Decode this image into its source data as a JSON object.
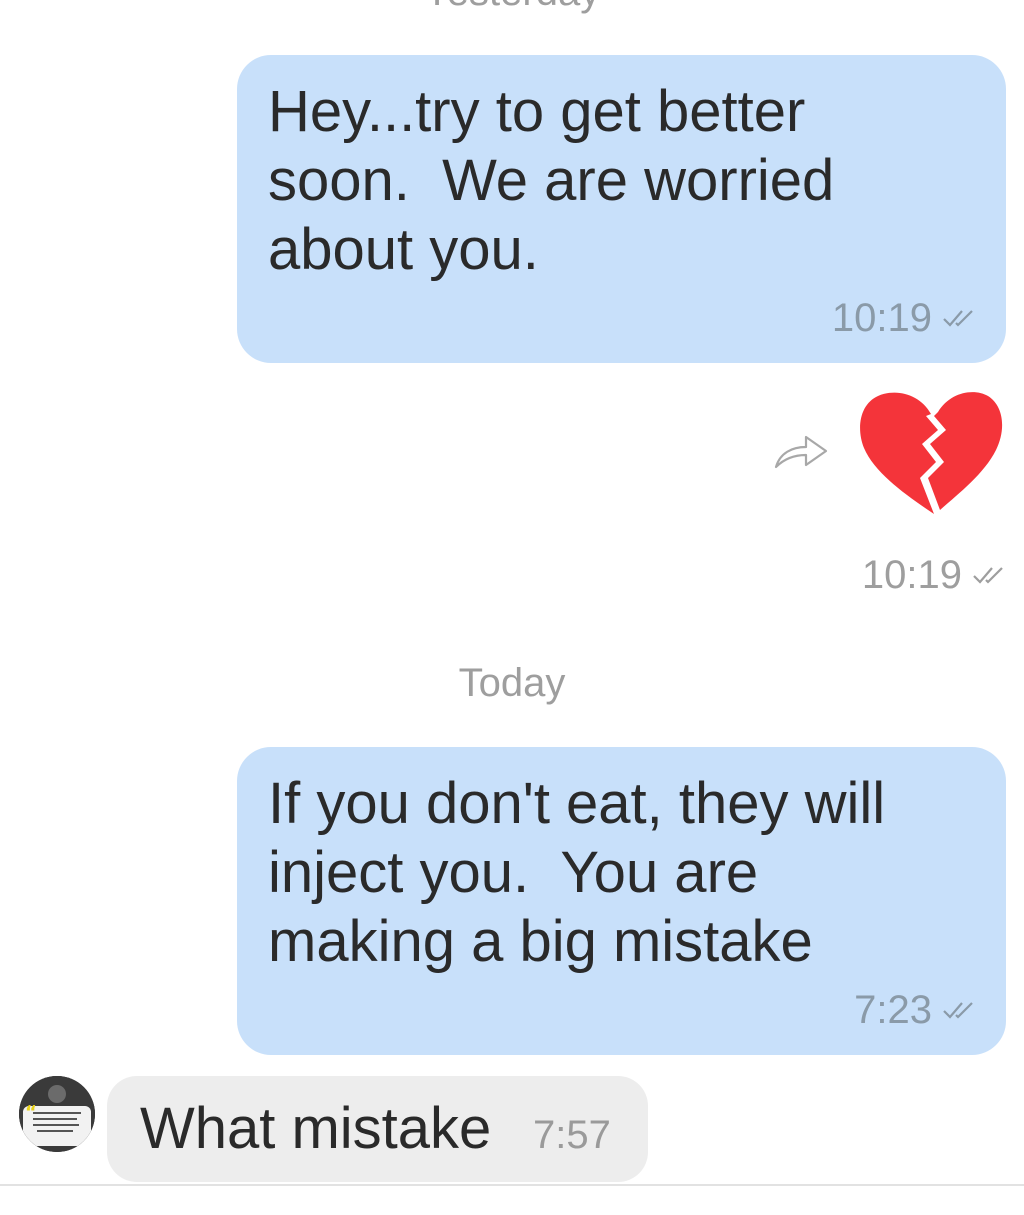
{
  "days": {
    "yesterday": "Yesterday",
    "today": "Today"
  },
  "messages": [
    {
      "direction": "outgoing",
      "text": "Hey...try to get better\nsoon.  We are worried\nabout you.",
      "time": "10:19",
      "status_icon": "double-check-icon"
    },
    {
      "direction": "outgoing",
      "type": "emoji",
      "emoji": "broken-heart-icon",
      "time": "10:19",
      "status_icon": "double-check-icon",
      "action_icon": "forward-icon"
    },
    {
      "direction": "outgoing",
      "text": "If you don't eat, they will\ninject you.  You are\nmaking a big mistake",
      "time": "7:23",
      "status_icon": "double-check-icon"
    },
    {
      "direction": "incoming",
      "text": "What mistake",
      "time": "7:57",
      "avatar": "contact-avatar"
    }
  ],
  "colors": {
    "outgoing_bubble": "#c8e0fa",
    "incoming_bubble": "#ededed",
    "heart": "#f4343a",
    "meta_text": "#8a9aa8"
  }
}
